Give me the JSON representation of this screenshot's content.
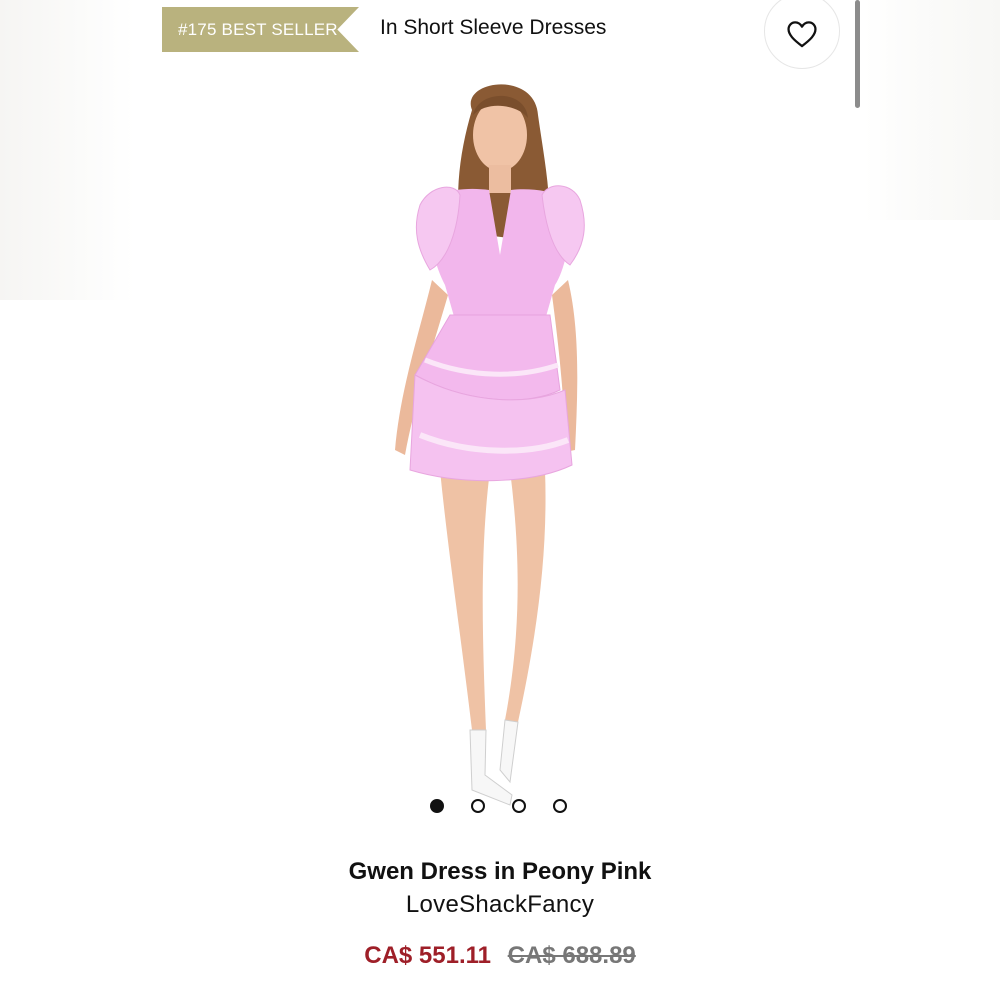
{
  "header": {
    "badge": "#175 BEST SELLER",
    "category": "In Short Sleeve Dresses",
    "wishlist_icon": "heart-outline-icon"
  },
  "carousel": {
    "total_slides": 4,
    "active_index": 0
  },
  "product": {
    "title": "Gwen Dress in Peony Pink",
    "brand": "LoveShackFancy",
    "sale_price": "CA$ 551.11",
    "original_price": "CA$ 688.89"
  },
  "colors": {
    "badge": "#b9b27e",
    "sale_price": "#9e1f28",
    "dress": "#f2b6ec"
  }
}
